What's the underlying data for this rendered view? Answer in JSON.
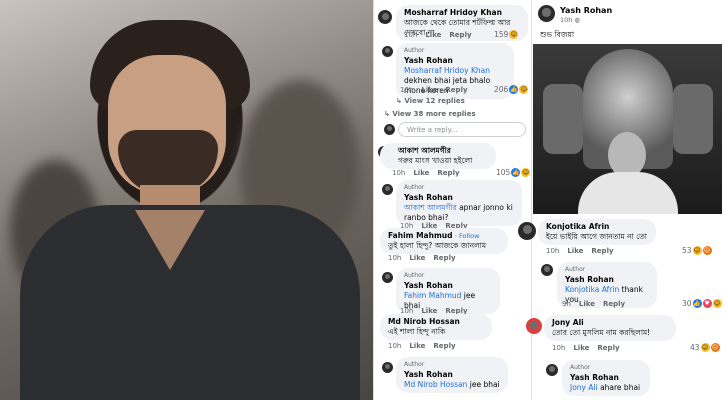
{
  "photo": {
    "alt": "actor portrait"
  },
  "col2": {
    "c1": {
      "name": "Mosharraf Hridoy Khan",
      "text": "আজকে থেকে তোমার শর্টফিল্ম আর দেখবো না",
      "time": "10h",
      "like": "Like",
      "reply": "Reply",
      "count": "159"
    },
    "c2": {
      "author": "Author",
      "name": "Yash Rohan",
      "mention": "Mosharraf Hridoy Khan",
      "text": " dekhen bhai jeta bhalo mone koren",
      "time": "10h",
      "like": "Like",
      "reply": "Reply",
      "count": "206"
    },
    "view12": "View 12 replies",
    "view38": "View 38 more replies",
    "write": "Write a reply...",
    "c3": {
      "name": "আকাশ আলমগীর",
      "text": "গরুর মাংস খাওয়া হইলো",
      "time": "10h",
      "like": "Like",
      "reply": "Reply",
      "count": "105"
    },
    "c4": {
      "author": "Author",
      "name": "Yash Rohan",
      "mention": "আকাশ আলমগীর",
      "text": " apnar jonno ki ranbo bhai?",
      "time": "10h",
      "like": "Like",
      "reply": "Reply"
    },
    "c5": {
      "name": "Fahim Mahmud",
      "follow": "· Follow",
      "text": "তুই হালা হিন্দু? আজকে জানলাম",
      "time": "10h",
      "like": "Like",
      "reply": "Reply"
    },
    "c6": {
      "author": "Author",
      "name": "Yash Rohan",
      "mention": "Fahim Mahmud",
      "text": " jee bhai",
      "time": "10h",
      "like": "Like",
      "reply": "Reply"
    },
    "c7": {
      "name": "Md Nirob Hossan",
      "text": "এই শালা হিন্দু নাকি",
      "time": "10h",
      "like": "Like",
      "reply": "Reply"
    },
    "c8": {
      "author": "Author",
      "name": "Yash Rohan",
      "mention": "Md Nirob Hossan",
      "text": " jee bhai"
    }
  },
  "col3": {
    "post": {
      "name": "Yash Rohan",
      "time": "10h",
      "caption": "শুভ বিজয়া"
    },
    "c1": {
      "name": "Konjotika Afrin",
      "text": "ইয়ে ভাইয়ি আগে জানতাম না তো",
      "time": "10h",
      "like": "Like",
      "reply": "Reply",
      "count": "53"
    },
    "c2": {
      "author": "Author",
      "name": "Yash Rohan",
      "mention": "Konjotika Afrin",
      "text": " thank you",
      "time": "9h",
      "like": "Like",
      "reply": "Reply",
      "count": "30"
    },
    "c3": {
      "name": "Jony Ali",
      "text": "তোর তো মুসলিম নাম করছিলাম!",
      "time": "10h",
      "like": "Like",
      "reply": "Reply",
      "count": "43"
    },
    "c4": {
      "author": "Author",
      "name": "Yash Rohan",
      "mention": "Jony Ali",
      "text": " ahare bhai"
    }
  }
}
